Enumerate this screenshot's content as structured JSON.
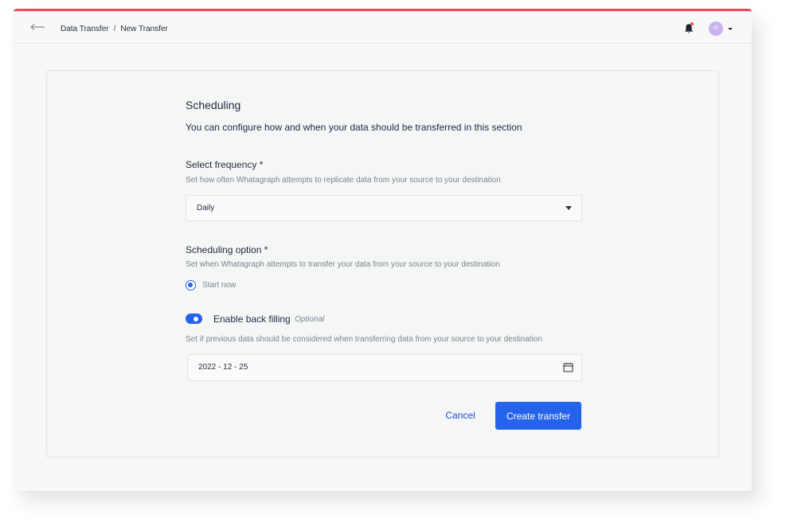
{
  "header": {
    "breadcrumb": [
      "Data Transfer",
      "New Transfer"
    ],
    "breadcrumb_separator": "/",
    "avatar_initials": "AT",
    "notification_dot_color": "#ec4b58"
  },
  "page": {
    "title": "Scheduling",
    "subtitle": "You can configure how and when your data should be transferred in this section"
  },
  "frequency": {
    "label": "Select frequency *",
    "hint": "Set how often Whatagraph attempts to replicate data from your source to your destination",
    "selected": "Daily"
  },
  "scheduling": {
    "label": "Scheduling option *",
    "hint": "Set when Whatagraph attempts to transfer your data from  your source to your destination",
    "option_label": "Start now",
    "option_selected": true
  },
  "backfill": {
    "toggle_label": "Enable back filling",
    "optional_tag": "Optional",
    "enabled": true,
    "hint": "Set if previous data should be considered when transferring data from your source to your destination",
    "date_value": "2022 - 12 - 25"
  },
  "actions": {
    "cancel_label": "Cancel",
    "create_label": "Create transfer"
  },
  "colors": {
    "accent": "#2563eb",
    "top_border": "#ec4b58",
    "avatar": "#c8b3ef"
  },
  "icons": [
    "back-arrow-icon",
    "bell-icon",
    "chevron-down-icon",
    "calendar-icon"
  ]
}
